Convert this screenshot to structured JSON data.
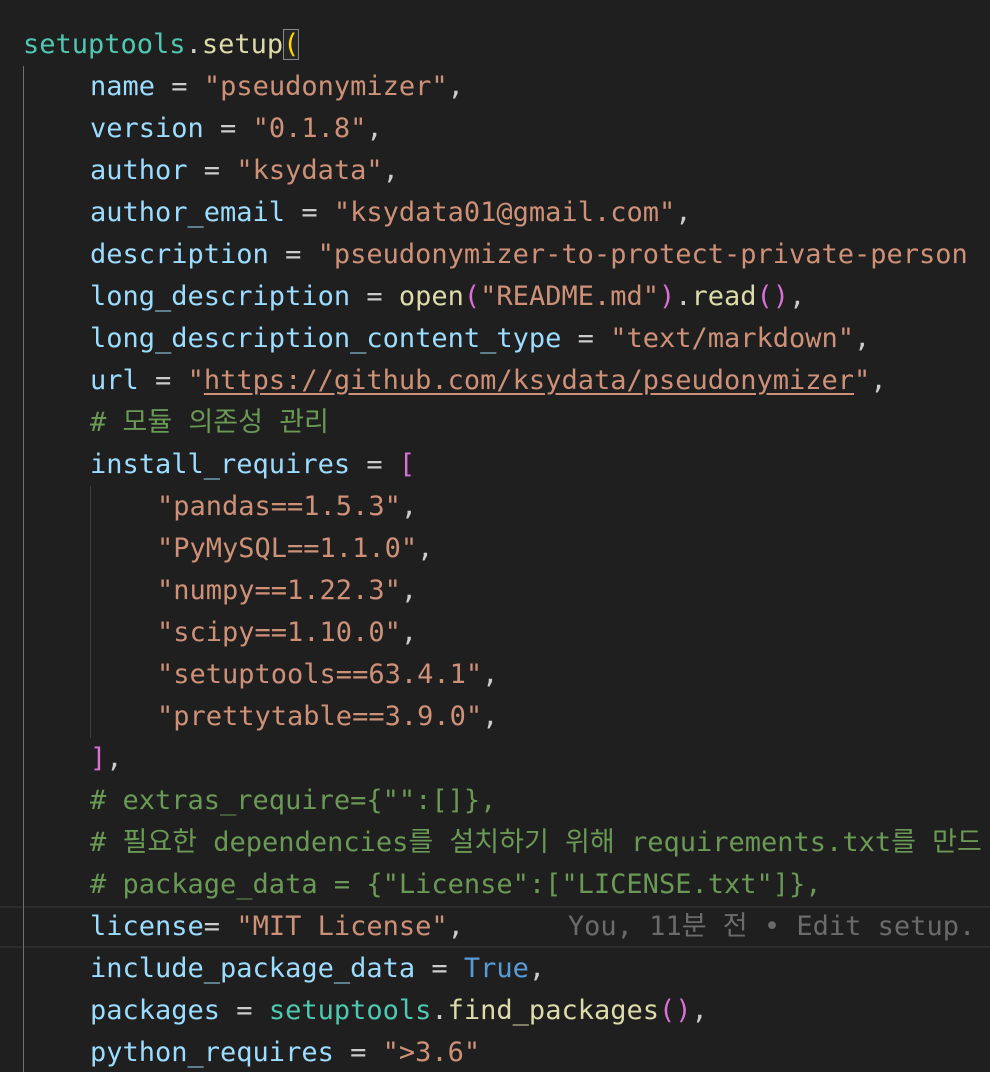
{
  "editor": {
    "lines": [
      {
        "indent": 0,
        "tokens": [
          {
            "t": "setuptools",
            "c": "mod"
          },
          {
            "t": ".",
            "c": "punc"
          },
          {
            "t": "setup",
            "c": "fn"
          },
          {
            "t": "(",
            "c": "p1",
            "match": true
          }
        ]
      },
      {
        "indent": 1,
        "tokens": [
          {
            "t": "name",
            "c": "var"
          },
          {
            "t": " = ",
            "c": "punc"
          },
          {
            "t": "\"pseudonymizer\"",
            "c": "str"
          },
          {
            "t": ",",
            "c": "punc"
          }
        ]
      },
      {
        "indent": 1,
        "tokens": [
          {
            "t": "version",
            "c": "var"
          },
          {
            "t": " = ",
            "c": "punc"
          },
          {
            "t": "\"0.1.8\"",
            "c": "str"
          },
          {
            "t": ",",
            "c": "punc"
          }
        ]
      },
      {
        "indent": 1,
        "tokens": [
          {
            "t": "author",
            "c": "var"
          },
          {
            "t": " = ",
            "c": "punc"
          },
          {
            "t": "\"ksydata\"",
            "c": "str"
          },
          {
            "t": ",",
            "c": "punc"
          }
        ]
      },
      {
        "indent": 1,
        "tokens": [
          {
            "t": "author_email",
            "c": "var"
          },
          {
            "t": " = ",
            "c": "punc"
          },
          {
            "t": "\"ksydata01@gmail.com\"",
            "c": "str"
          },
          {
            "t": ",",
            "c": "punc"
          }
        ]
      },
      {
        "indent": 1,
        "tokens": [
          {
            "t": "description",
            "c": "var"
          },
          {
            "t": " = ",
            "c": "punc"
          },
          {
            "t": "\"pseudonymizer-to-protect-private-person",
            "c": "str"
          }
        ]
      },
      {
        "indent": 1,
        "tokens": [
          {
            "t": "long_description",
            "c": "var"
          },
          {
            "t": " = ",
            "c": "punc"
          },
          {
            "t": "open",
            "c": "fn"
          },
          {
            "t": "(",
            "c": "p2"
          },
          {
            "t": "\"README.md\"",
            "c": "str"
          },
          {
            "t": ")",
            "c": "p2"
          },
          {
            "t": ".",
            "c": "punc"
          },
          {
            "t": "read",
            "c": "fn"
          },
          {
            "t": "()",
            "c": "p2"
          },
          {
            "t": ",",
            "c": "punc"
          }
        ]
      },
      {
        "indent": 1,
        "tokens": [
          {
            "t": "long_description_content_type",
            "c": "var"
          },
          {
            "t": " = ",
            "c": "punc"
          },
          {
            "t": "\"text/markdown\"",
            "c": "str"
          },
          {
            "t": ",",
            "c": "punc"
          }
        ]
      },
      {
        "indent": 1,
        "tokens": [
          {
            "t": "url",
            "c": "var"
          },
          {
            "t": " = ",
            "c": "punc"
          },
          {
            "t": "\"",
            "c": "str"
          },
          {
            "t": "https://github.com/ksydata/pseudonymizer",
            "c": "str",
            "link": true
          },
          {
            "t": "\"",
            "c": "str"
          },
          {
            "t": ",",
            "c": "punc"
          }
        ]
      },
      {
        "indent": 1,
        "tokens": [
          {
            "t": "# 모듈 의존성 관리",
            "c": "comment"
          }
        ]
      },
      {
        "indent": 1,
        "tokens": [
          {
            "t": "install_requires",
            "c": "var"
          },
          {
            "t": " = ",
            "c": "punc"
          },
          {
            "t": "[",
            "c": "p2"
          }
        ]
      },
      {
        "indent": 2,
        "tokens": [
          {
            "t": "\"pandas==1.5.3\"",
            "c": "str"
          },
          {
            "t": ",",
            "c": "punc"
          }
        ]
      },
      {
        "indent": 2,
        "tokens": [
          {
            "t": "\"PyMySQL==1.1.0\"",
            "c": "str"
          },
          {
            "t": ",",
            "c": "punc"
          }
        ]
      },
      {
        "indent": 2,
        "tokens": [
          {
            "t": "\"numpy==1.22.3\"",
            "c": "str"
          },
          {
            "t": ",",
            "c": "punc"
          }
        ]
      },
      {
        "indent": 2,
        "tokens": [
          {
            "t": "\"scipy==1.10.0\"",
            "c": "str"
          },
          {
            "t": ",",
            "c": "punc"
          }
        ]
      },
      {
        "indent": 2,
        "tokens": [
          {
            "t": "\"setuptools==63.4.1\"",
            "c": "str"
          },
          {
            "t": ",",
            "c": "punc"
          }
        ]
      },
      {
        "indent": 2,
        "tokens": [
          {
            "t": "\"prettytable==3.9.0\"",
            "c": "str"
          },
          {
            "t": ",",
            "c": "punc"
          }
        ]
      },
      {
        "indent": 1,
        "tokens": [
          {
            "t": "]",
            "c": "p2"
          },
          {
            "t": ",",
            "c": "punc"
          }
        ]
      },
      {
        "indent": 1,
        "tokens": [
          {
            "t": "# extras_require={\"\":[]},",
            "c": "comment"
          }
        ]
      },
      {
        "indent": 1,
        "tokens": [
          {
            "t": "# 필요한 dependencies를 설치하기 위해 requirements.txt를 만드",
            "c": "comment"
          }
        ]
      },
      {
        "indent": 1,
        "tokens": [
          {
            "t": "# package_data = {\"License\":[\"LICENSE.txt\"]},",
            "c": "comment"
          }
        ]
      },
      {
        "indent": 1,
        "current": true,
        "tokens": [
          {
            "t": "license",
            "c": "var"
          },
          {
            "t": "= ",
            "c": "punc"
          },
          {
            "t": "\"MIT License\"",
            "c": "str"
          },
          {
            "t": ",",
            "c": "punc"
          }
        ],
        "blame": "You, 11분 전 • Edit setup."
      },
      {
        "indent": 1,
        "tokens": [
          {
            "t": "include_package_data",
            "c": "var"
          },
          {
            "t": " = ",
            "c": "punc"
          },
          {
            "t": "True",
            "c": "kw"
          },
          {
            "t": ",",
            "c": "punc"
          }
        ]
      },
      {
        "indent": 1,
        "tokens": [
          {
            "t": "packages",
            "c": "var"
          },
          {
            "t": " = ",
            "c": "punc"
          },
          {
            "t": "setuptools",
            "c": "mod"
          },
          {
            "t": ".",
            "c": "punc"
          },
          {
            "t": "find_packages",
            "c": "fn"
          },
          {
            "t": "()",
            "c": "p2"
          },
          {
            "t": ",",
            "c": "punc"
          }
        ]
      },
      {
        "indent": 1,
        "tokens": [
          {
            "t": "python_requires",
            "c": "var"
          },
          {
            "t": " = ",
            "c": "punc"
          },
          {
            "t": "\">3.6\"",
            "c": "str"
          }
        ]
      }
    ]
  }
}
